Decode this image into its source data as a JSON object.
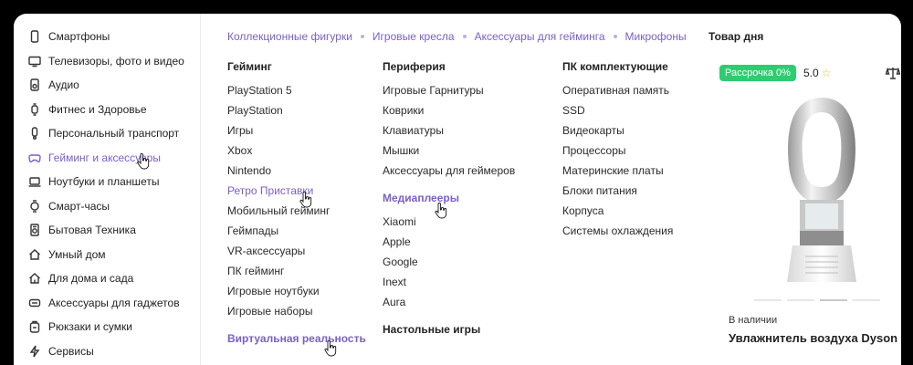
{
  "sidebar": {
    "items": [
      {
        "label": "Смартфоны",
        "icon": "smartphone-icon"
      },
      {
        "label": "Телевизоры, фото и видео",
        "icon": "tv-icon"
      },
      {
        "label": "Аудио",
        "icon": "speaker-icon"
      },
      {
        "label": "Фитнес и Здоровье",
        "icon": "fitness-tracker-icon"
      },
      {
        "label": "Персональный транспорт",
        "icon": "scooter-icon"
      },
      {
        "label": "Гейминг и аксессуары",
        "icon": "gamepad-icon",
        "active": true
      },
      {
        "label": "Ноутбуки и планшеты",
        "icon": "laptop-icon"
      },
      {
        "label": "Смарт-часы",
        "icon": "watch-icon"
      },
      {
        "label": "Бытовая Техника",
        "icon": "appliance-icon"
      },
      {
        "label": "Умный дом",
        "icon": "smart-home-icon"
      },
      {
        "label": "Для дома и сада",
        "icon": "garden-icon"
      },
      {
        "label": "Аксессуары для гаджетов",
        "icon": "accessories-icon"
      },
      {
        "label": "Рюкзаки и сумки",
        "icon": "backpack-icon"
      },
      {
        "label": "Сервисы",
        "icon": "bolt-icon"
      }
    ]
  },
  "breadcrumb": [
    "Коллекционные фигурки",
    "Игровые кресла",
    "Аксессуары для гейминга",
    "Микрофоны"
  ],
  "columns": {
    "gaming": {
      "title": "Гейминг",
      "items": [
        "PlayStation 5",
        "PlayStation",
        "Игры",
        "Xbox",
        "Nintendo",
        "Ретро Приставки",
        "Мобильный гейминг",
        "Геймпады",
        "VR-аксессуары",
        "ПК гейминг",
        "Игровые ноутбуки",
        "Игровые наборы"
      ],
      "sub_title": "Виртуальная реальность"
    },
    "periphery": {
      "title": "Периферия",
      "items": [
        "Игровые Гарнитуры",
        "Коврики",
        "Клавиатуры",
        "Мышки",
        "Аксессуары для геймеров"
      ],
      "sub_title": "Медиаплееры",
      "sub_items": [
        "Xiaomi",
        "Apple",
        "Google",
        "Inext",
        "Aura"
      ],
      "sub_title2": "Настольные игры"
    },
    "pc": {
      "title": "ПК комплектующие",
      "items": [
        "Оперативная память",
        "SSD",
        "Видеокарты",
        "Процессоры",
        "Материнские платы",
        "Блоки питания",
        "Корпуса",
        "Системы охлаждения"
      ]
    }
  },
  "product": {
    "section_title": "Товар дня",
    "badge": "Рассрочка 0%",
    "rating": "5.0",
    "rating_icon": "star-icon",
    "compare_icon": "scales-icon",
    "availability": "В наличии",
    "name": "Увлажнитель воздуха Dyson"
  },
  "colors": {
    "accent": "#7b5fc6",
    "badge": "#2ecc71",
    "star": "#f5c518"
  }
}
